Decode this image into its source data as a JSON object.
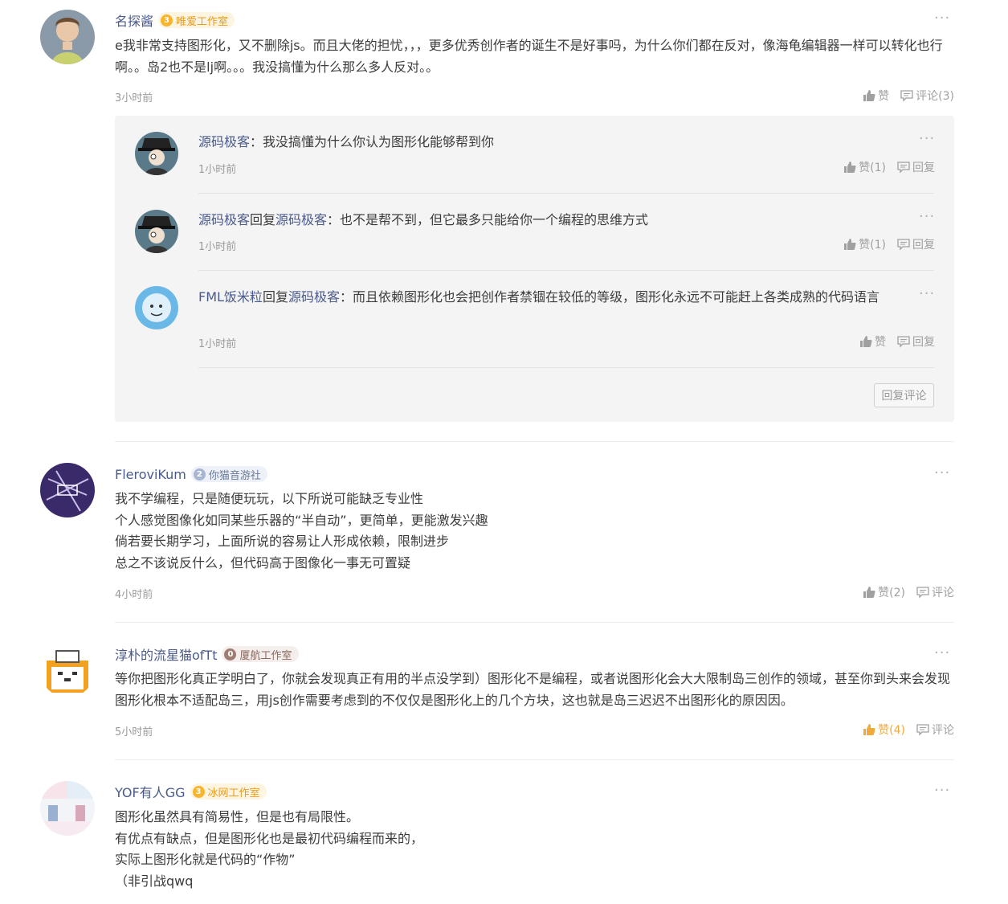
{
  "colors": {
    "link": "#4a5a8a",
    "liked": "#f2a93b",
    "gold_badge": "#f7b42c"
  },
  "comments": [
    {
      "user": "名探酱",
      "badge": {
        "level": "3",
        "name": "唯爱工作室"
      },
      "text": "e我非常支持图形化，又不删除js。而且大佬的担忧，，，更多优秀创作者的诞生不是好事吗，为什么你们都在反对，像海龟编辑器一样可以转化也行啊。。岛2也不是lj啊。。。我没搞懂为什么那么多人反对。。",
      "time": "3小时前",
      "like": "赞",
      "comment": "评论(3)",
      "replies": [
        {
          "user": "源码极客",
          "reply_to": "",
          "reply_word": "",
          "text": "：我没搞懂为什么你认为图形化能够帮到你",
          "time": "1小时前",
          "like": "赞(1)",
          "reply": "回复"
        },
        {
          "user": "源码极客",
          "reply_to": "源码极客",
          "reply_word": "回复",
          "text": "：也不是帮不到，但它最多只能给你一个编程的思维方式",
          "time": "1小时前",
          "like": "赞(1)",
          "reply": "回复"
        },
        {
          "user": "FML饭米粒",
          "reply_to": "源码极客",
          "reply_word": "回复",
          "text": "：而且依赖图形化也会把创作者禁锢在较低的等级，图形化永远不可能赶上各类成熟的代码语言",
          "time": "1小时前",
          "like": "赞",
          "reply": "回复"
        }
      ],
      "reply_button": "回复评论"
    },
    {
      "user": "FleroviKum",
      "badge": {
        "level": "2",
        "name": "你猫音游社"
      },
      "lines": [
        "我不学编程，只是随便玩玩，以下所说可能缺乏专业性",
        "个人感觉图像化如同某些乐器的“半自动”，更简单，更能激发兴趣",
        "倘若要长期学习，上面所说的容易让人形成依赖，限制进步",
        "总之不该说反什么，但代码高于图像化一事无可置疑"
      ],
      "time": "4小时前",
      "like": "赞(2)",
      "comment": "评论"
    },
    {
      "user": "淳朴的流星猫ofTt",
      "badge": {
        "level": "0",
        "name": "厦航工作室"
      },
      "text": "等你把图形化真正学明白了，你就会发现真正有用的半点没学到）图形化不是编程，或者说图形化会大大限制岛三创作的领域，甚至你到头来会发现图形化根本不适配岛三，用js创作需要考虑到的不仅仅是图形化上的几个方块，这也就是岛三迟迟不出图形化的原因因。",
      "time": "5小时前",
      "like": "赞(4)",
      "comment": "评论"
    },
    {
      "user": "YOF有人GG",
      "badge": {
        "level": "3",
        "name": "冰网工作室"
      },
      "lines": [
        "图形化虽然具有简易性，但是也有局限性。",
        "有优点有缺点，但是图形化也是最初代码编程而来的，",
        "实际上图形化就是代码的“作物”",
        "（非引战qwq"
      ]
    }
  ]
}
